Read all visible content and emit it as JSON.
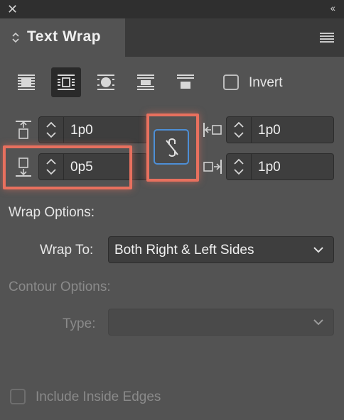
{
  "window": {
    "close_glyph": "✕",
    "collapse_glyph": "‹‹"
  },
  "tab": {
    "title": "Text Wrap"
  },
  "wrap_modes": [
    {
      "name": "no-text-wrap",
      "active": false
    },
    {
      "name": "wrap-bounding-box",
      "active": true
    },
    {
      "name": "wrap-object-shape",
      "active": false
    },
    {
      "name": "jump-object",
      "active": false
    },
    {
      "name": "jump-to-next-column",
      "active": false
    }
  ],
  "invert": {
    "label": "Invert",
    "checked": false
  },
  "offsets": {
    "top": "1p0",
    "bottom": "0p5",
    "left": "1p0",
    "right": "1p0"
  },
  "wrap_options": {
    "heading": "Wrap Options:",
    "wrap_to_label": "Wrap To:",
    "wrap_to_value": "Both Right & Left Sides"
  },
  "contour_options": {
    "heading": "Contour Options:",
    "type_label": "Type:",
    "type_value": ""
  },
  "include_inside_edges": {
    "label": "Include Inside Edges",
    "checked": false
  },
  "colors": {
    "accent": "#4d8fd6",
    "highlight": "#e8705e"
  }
}
